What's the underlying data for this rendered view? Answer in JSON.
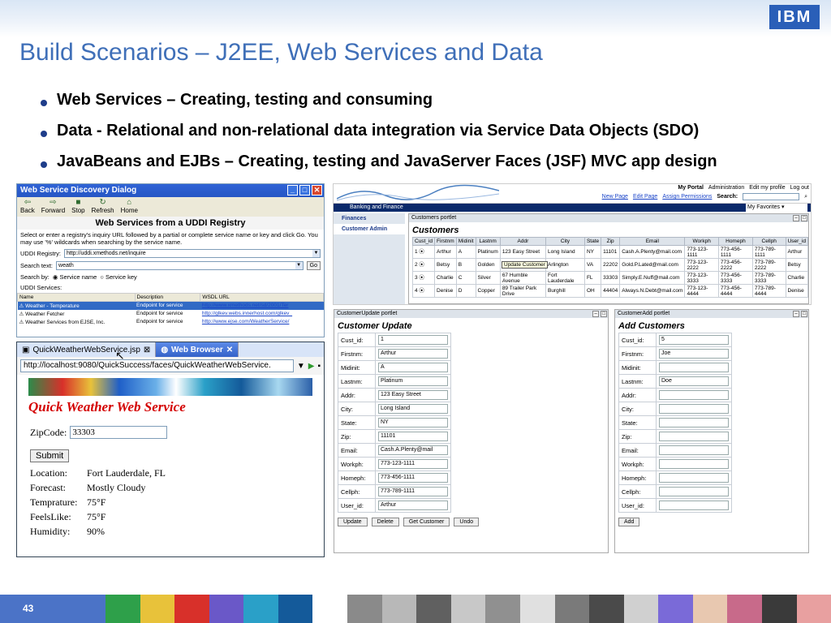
{
  "slide": {
    "title": "Build Scenarios – J2EE, Web Services and Data",
    "logo": "IBM",
    "page_number": "43",
    "bullets": [
      "Web Services – Creating, testing and consuming",
      "Data - Relational and non-relational data integration via Service Data Objects (SDO)",
      "JavaBeans and EJBs – Creating, testing and JavaServer Faces (JSF) MVC app design"
    ]
  },
  "discovery": {
    "title": "Web Service Discovery Dialog",
    "toolbar": [
      "Back",
      "Forward",
      "Stop",
      "Refresh",
      "Home"
    ],
    "heading": "Web Services from a UDDI Registry",
    "instructions": "Select or enter a registry's inquiry URL followed by a partial or complete service name or key and click Go.  You may use '%' wildcards when searching by the service name.",
    "registry_label": "UDDI Registry:",
    "registry_value": "http://uddi.xmethods.net/inquire",
    "search_label": "Search text:",
    "search_value": "weath",
    "go_label": "Go",
    "searchby_label": "Search by:",
    "radio_name": "Service name",
    "radio_key": "Service key",
    "services_label": "UDDI Services:",
    "columns": [
      "Name",
      "Description",
      "WSDL URL"
    ],
    "rows": [
      {
        "name": "Weather - Temperature",
        "desc": "Endpoint for service",
        "url": "http://www.xmethods.net/sd/2001/Ter"
      },
      {
        "name": "Weather Fetcher",
        "desc": "Endpoint for service",
        "url": "http://glkev.webs.innerhost.com/glkev_"
      },
      {
        "name": "Weather Services from EJSE, Inc.",
        "desc": "Endpoint for service",
        "url": "http://www.ejse.com/WeatherService/"
      }
    ]
  },
  "weather": {
    "tab1": "QuickWeatherWebService.jsp",
    "tab2": "Web Browser",
    "url": "http://localhost:9080/QuickSuccess/faces/QuickWeatherWebService.",
    "heading": "Quick Weather Web Service",
    "zip_label": "ZipCode:",
    "zip_value": "33303",
    "submit": "Submit",
    "fields": [
      {
        "k": "Location:",
        "v": "Fort Lauderdale, FL"
      },
      {
        "k": "Forecast:",
        "v": "Mostly Cloudy"
      },
      {
        "k": "Temprature:",
        "v": "75°F"
      },
      {
        "k": "FeelsLike:",
        "v": "75°F"
      },
      {
        "k": "Humidity:",
        "v": "90%"
      }
    ]
  },
  "portal": {
    "top_links": [
      "My Portal",
      "Administration",
      "Edit my profile",
      "Log out"
    ],
    "sub_links": [
      "New Page",
      "Edit Page",
      "Assign Permissions"
    ],
    "search_label": "Search:",
    "bar_title": "Banking and Finance",
    "favorites": "My Favorites",
    "side": [
      "Finances",
      "Customer Admin"
    ],
    "customers": {
      "bar": "Customers portlet",
      "title": "Customers",
      "tooltip": "Update Customer",
      "columns": [
        "Cust_id",
        "Firstnm",
        "Midinit",
        "Lastnm",
        "Addr",
        "City",
        "State",
        "Zip",
        "Email",
        "Workph",
        "Homeph",
        "Cellph",
        "User_id"
      ],
      "rows": [
        [
          "1",
          "Arthur",
          "A",
          "Platinum",
          "123 Easy Street",
          "Long Island",
          "NY",
          "11101",
          "Cash.A.Plenty@mail.com",
          "773-123-1111",
          "773-456-1111",
          "773-789-1111",
          "Arthur"
        ],
        [
          "2",
          "Betsy",
          "B",
          "Golden",
          "45 Plush Circle",
          "Arlington",
          "VA",
          "22202",
          "Gold.P.Lated@mail.com",
          "773-123-2222",
          "773-456-2222",
          "773-789-2222",
          "Betsy"
        ],
        [
          "3",
          "Charlie",
          "C",
          "Silver",
          "67 Humble Avenue",
          "Fort Lauderdale",
          "FL",
          "33303",
          "Simply.E.Nuff@mail.com",
          "773-123-3333",
          "773-456-3333",
          "773-789-3333",
          "Charlie"
        ],
        [
          "4",
          "Denise",
          "D",
          "Copper",
          "89 Trailer Park Drive",
          "Burghill",
          "OH",
          "44404",
          "Always.N.Debt@mail.com",
          "773-123-4444",
          "773-456-4444",
          "773-789-4444",
          "Denise"
        ]
      ]
    },
    "update": {
      "bar": "CustomerUpdate portlet",
      "title": "Customer Update",
      "fields": [
        {
          "k": "Cust_id:",
          "v": "1"
        },
        {
          "k": "Firstnm:",
          "v": "Arthur"
        },
        {
          "k": "Midinit:",
          "v": "A"
        },
        {
          "k": "Lastnm:",
          "v": "Platinum"
        },
        {
          "k": "Addr:",
          "v": "123 Easy Street"
        },
        {
          "k": "City:",
          "v": "Long Island"
        },
        {
          "k": "State:",
          "v": "NY"
        },
        {
          "k": "Zip:",
          "v": "11101"
        },
        {
          "k": "Email:",
          "v": "Cash.A.Plenty@mail"
        },
        {
          "k": "Workph:",
          "v": "773-123-1111"
        },
        {
          "k": "Homeph:",
          "v": "773-456-1111"
        },
        {
          "k": "Cellph:",
          "v": "773-789-1111"
        },
        {
          "k": "User_id:",
          "v": "Arthur"
        }
      ],
      "buttons": [
        "Update",
        "Delete",
        "Get Customer",
        "Undo"
      ]
    },
    "add": {
      "bar": "CustomerAdd portlet",
      "title": "Add Customers",
      "fields": [
        {
          "k": "Cust_id:",
          "v": "5"
        },
        {
          "k": "Firstnm:",
          "v": "Joe"
        },
        {
          "k": "Midinit:",
          "v": ""
        },
        {
          "k": "Lastnm:",
          "v": "Doe"
        },
        {
          "k": "Addr:",
          "v": ""
        },
        {
          "k": "City:",
          "v": ""
        },
        {
          "k": "State:",
          "v": ""
        },
        {
          "k": "Zip:",
          "v": ""
        },
        {
          "k": "Email:",
          "v": ""
        },
        {
          "k": "Workph:",
          "v": ""
        },
        {
          "k": "Homeph:",
          "v": ""
        },
        {
          "k": "Cellph:",
          "v": ""
        },
        {
          "k": "User_id:",
          "v": ""
        }
      ],
      "button": "Add"
    }
  },
  "colors": {
    "title": "#3f6fb8",
    "footer": "#4b73c7",
    "strip": [
      "#2ea04a",
      "#e8c23a",
      "#d8302a",
      "#6a58c8",
      "#2aa0c8",
      "#145a9a",
      "#ffffff",
      "#8a8a8a",
      "#b8b8b8",
      "#606060",
      "#c8c8c8",
      "#909090",
      "#e0e0e0",
      "#7a7a7a",
      "#4a4a4a",
      "#d0d0d0",
      "#7a6ad8",
      "#e8c8b0",
      "#c86a8a",
      "#3a3a3a",
      "#e8a0a0"
    ]
  }
}
